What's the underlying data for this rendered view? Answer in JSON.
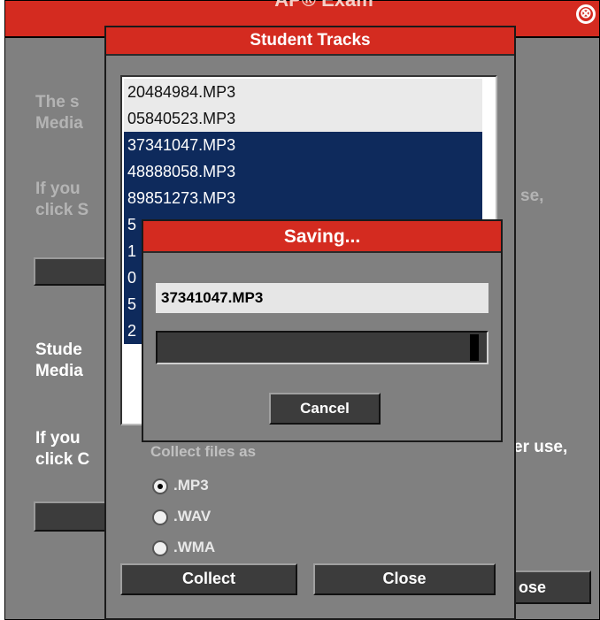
{
  "main": {
    "title": "AP® Exam",
    "close_glyph": "⊗",
    "close_icon": "close-circle-icon",
    "para1_line1": "The s",
    "para1_line2": "Media",
    "para2_line1": "If you",
    "para2_line2": "click S",
    "para2_right": "se,",
    "section2_line1": "Stude",
    "section2_line2": "Media",
    "para3_line1": "If you",
    "para3_line2": "click C",
    "para3_right": "er use,",
    "close_button_partial": "ose"
  },
  "tracks": {
    "title": "Student Tracks",
    "items": [
      {
        "label": "20484984.MP3",
        "state": "normal"
      },
      {
        "label": "05840523.MP3",
        "state": "normal"
      },
      {
        "label": "37341047.MP3",
        "state": "selected"
      },
      {
        "label": "48888058.MP3",
        "state": "selected"
      },
      {
        "label": "89851273.MP3",
        "state": "selected"
      },
      {
        "label": "5",
        "state": "selected"
      },
      {
        "label": "1",
        "state": "selected"
      },
      {
        "label": "0",
        "state": "selected"
      },
      {
        "label": "5",
        "state": "selected"
      },
      {
        "label": "2",
        "state": "selected"
      }
    ],
    "collect_label": "Collect files as",
    "formats": [
      {
        "label": ".MP3",
        "checked": true
      },
      {
        "label": ".WAV",
        "checked": false
      },
      {
        "label": ".WMA",
        "checked": false
      }
    ],
    "collect_button": "Collect",
    "close_button": "Close"
  },
  "saving": {
    "title": "Saving...",
    "filename": "37341047.MP3",
    "progress": 0.98,
    "cancel_button": "Cancel"
  },
  "colors": {
    "title_bar": "#d42b20",
    "selection": "#0e2a5c",
    "window_bg": "#808080",
    "button_bg": "#3c3c3c"
  }
}
